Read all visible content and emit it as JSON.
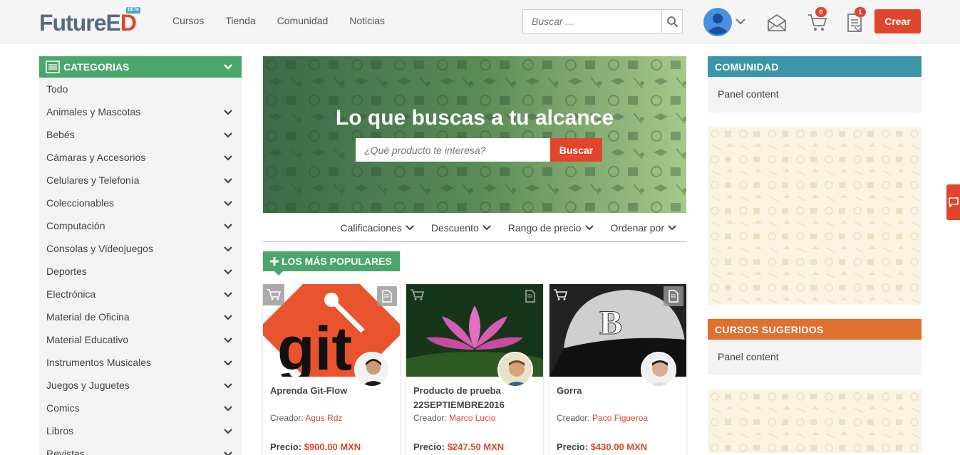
{
  "header": {
    "logo_main": "FutureE",
    "logo_accent": "D",
    "beta": "BETA",
    "nav": [
      "Cursos",
      "Tienda",
      "Comunidad",
      "Noticias"
    ],
    "search_placeholder": "Buscar ...",
    "cart_count": "0",
    "notes_count": "1",
    "create_label": "Crear"
  },
  "sidebar": {
    "title": "CATEGORIAS",
    "items": [
      {
        "label": "Todo",
        "expandable": false
      },
      {
        "label": "Animales y Mascotas",
        "expandable": true
      },
      {
        "label": "Bebés",
        "expandable": true
      },
      {
        "label": "Cámaras y Accesorios",
        "expandable": true
      },
      {
        "label": "Celulares y Telefonía",
        "expandable": true
      },
      {
        "label": "Coleccionables",
        "expandable": true
      },
      {
        "label": "Computación",
        "expandable": true
      },
      {
        "label": "Consolas y Videojuegos",
        "expandable": true
      },
      {
        "label": "Deportes",
        "expandable": true
      },
      {
        "label": "Electrónica",
        "expandable": true
      },
      {
        "label": "Material de Oficina",
        "expandable": true
      },
      {
        "label": "Material Educativo",
        "expandable": true
      },
      {
        "label": "Instrumentos Musicales",
        "expandable": true
      },
      {
        "label": "Juegos y Juguetes",
        "expandable": true
      },
      {
        "label": "Comics",
        "expandable": true
      },
      {
        "label": "Libros",
        "expandable": true
      },
      {
        "label": "Revistas",
        "expandable": true
      }
    ]
  },
  "hero": {
    "title": "Lo que buscas a tu alcance",
    "search_placeholder": "¿Qué producto te interesa?",
    "search_button": "Buscar"
  },
  "filters": [
    "Calificaciones",
    "Descuento",
    "Rango de precio",
    "Ordenar por"
  ],
  "popular_label": "LOS MÁS POPULARES",
  "cards": [
    {
      "name": "Aprenda Git-Flow",
      "creator_label": "Creador:",
      "creator": "Agus Rdz",
      "price_label": "Precio:",
      "price": "$900.00 MXN",
      "image": "git-logo"
    },
    {
      "name": "Producto de prueba 22SEPTIEMBRE2016",
      "creator_label": "Creador:",
      "creator": "Marco Lucio",
      "price_label": "Precio:",
      "price": "$247.50 MXN",
      "image": "lotus-flower"
    },
    {
      "name": "Gorra",
      "creator_label": "Creador:",
      "creator": "Paco Figueroa",
      "price_label": "Precio:",
      "price": "$430.00 MXN",
      "image": "baseball-cap"
    }
  ],
  "right": {
    "community_title": "COMUNIDAD",
    "community_body": "Panel content",
    "courses_title": "CURSOS SUGERIDOS",
    "courses_body": "Panel content"
  },
  "colors": {
    "brand_red": "#e0462d",
    "green": "#4aa66a",
    "teal": "#3a95a8",
    "orange": "#e0702d"
  }
}
